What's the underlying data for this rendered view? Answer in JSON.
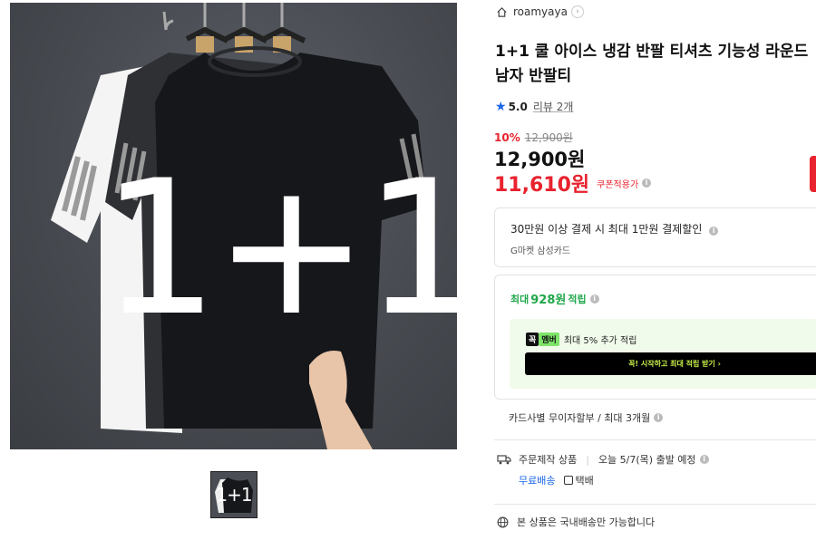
{
  "seller": {
    "name": "roamyaya",
    "icon": "home-icon",
    "arrow_icon": "chevron-right-icon"
  },
  "product": {
    "title": "1+1 쿨 아이스 냉감 반팔 티셔츠 기능성 라운드 남자 반팔티",
    "image_overlay_text": "1+1",
    "thumbnail_text": "1+1"
  },
  "rating": {
    "score": "5.0",
    "reviews": "리뷰 2개",
    "icon": "star-icon",
    "color": "#1a66e8"
  },
  "price": {
    "discount_rate": "10%",
    "original": "12,900원",
    "sale": "12,900원",
    "coupon_price": "11,610원",
    "coupon_label": "쿠폰적용가",
    "accent": "#e8222e"
  },
  "promo": {
    "title": "30만원 이상 결제 시 최대 1만원 결제할인",
    "subtitle": "G마켓 삼성카드"
  },
  "points": {
    "prefix": "최대",
    "amount": "928원",
    "suffix": "적립",
    "color": "#1fa74a"
  },
  "membership": {
    "badge1": "꼭",
    "badge2": "멤버",
    "text": "최대 5% 추가 적립",
    "button": "꼭! 시작하고 최대 적립 받기 ›"
  },
  "installment": "카드사별 무이자할부 / 최대 3개월",
  "shipping": {
    "order_type": "주문제작 상품",
    "dispatch": "오늘 5/7(목) 출발 예정",
    "free": "무료배송",
    "type": "택배"
  },
  "domestic": "본 상품은 국내배송만 가능합니다"
}
